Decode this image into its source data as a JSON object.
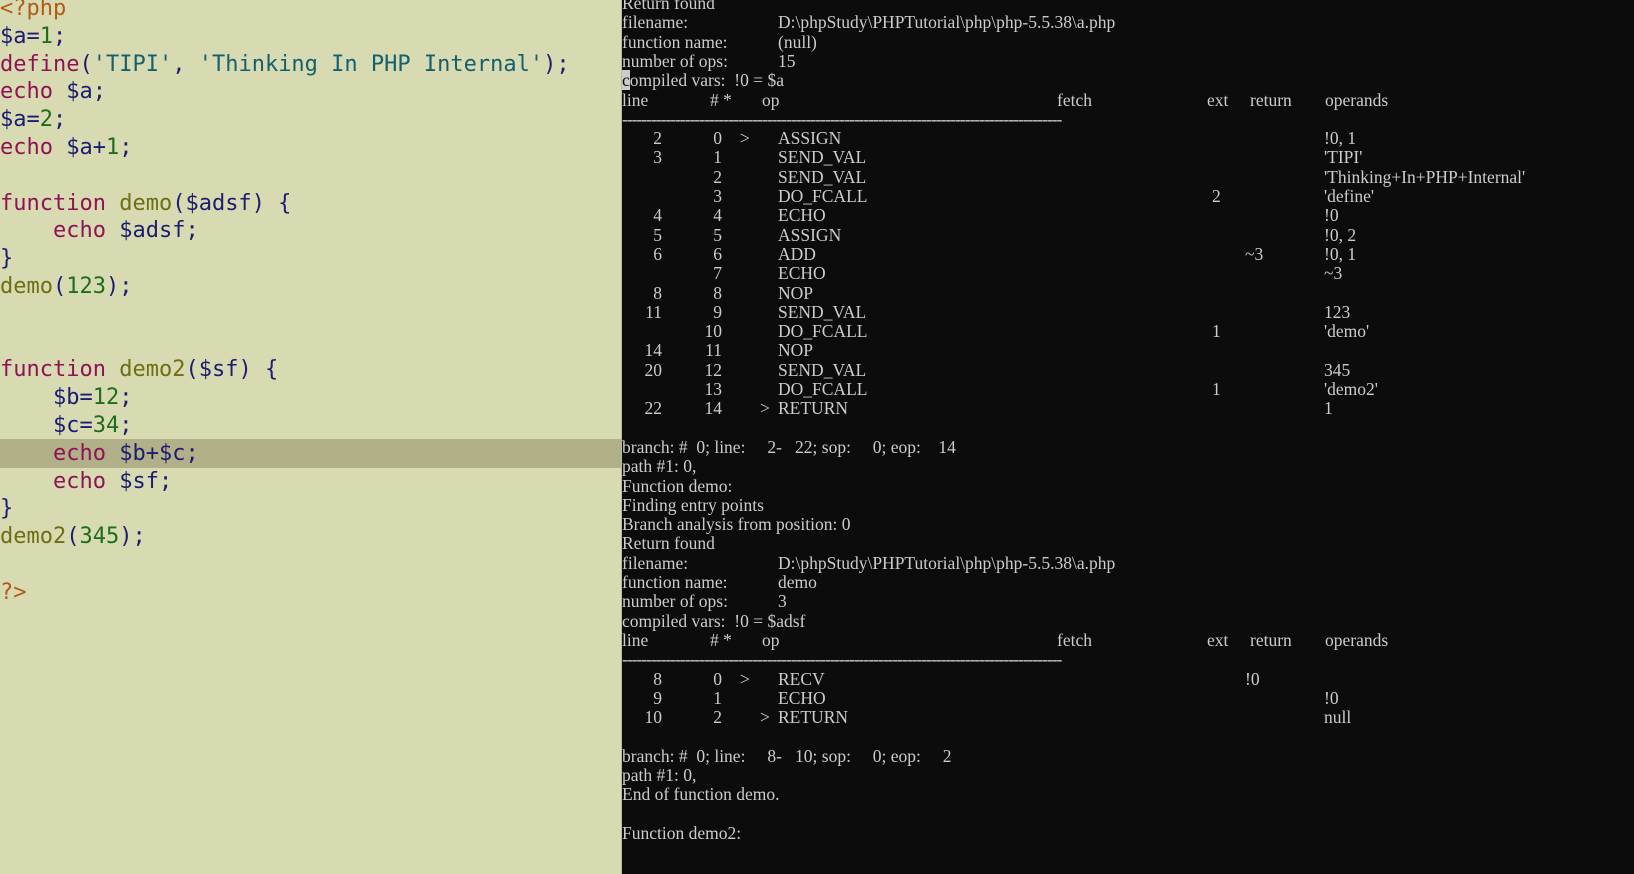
{
  "editor": {
    "current_line_index": 16,
    "lines": [
      [
        {
          "t": "<?php",
          "c": "tag"
        }
      ],
      [
        {
          "t": "$a",
          "c": "var"
        },
        {
          "t": "=",
          "c": "punc"
        },
        {
          "t": "1",
          "c": "num"
        },
        {
          "t": ";",
          "c": "punc"
        }
      ],
      [
        {
          "t": "define",
          "c": "kw"
        },
        {
          "t": "(",
          "c": "punc"
        },
        {
          "t": "'TIPI'",
          "c": "str"
        },
        {
          "t": ", ",
          "c": "punc"
        },
        {
          "t": "'Thinking In PHP Internal'",
          "c": "str"
        },
        {
          "t": ");",
          "c": "punc"
        }
      ],
      [
        {
          "t": "echo",
          "c": "kw"
        },
        {
          "t": " $a;",
          "c": "var"
        }
      ],
      [
        {
          "t": "$a",
          "c": "var"
        },
        {
          "t": "=",
          "c": "punc"
        },
        {
          "t": "2",
          "c": "num"
        },
        {
          "t": ";",
          "c": "punc"
        }
      ],
      [
        {
          "t": "echo",
          "c": "kw"
        },
        {
          "t": " $a",
          "c": "var"
        },
        {
          "t": "+",
          "c": "punc"
        },
        {
          "t": "1",
          "c": "num"
        },
        {
          "t": ";",
          "c": "punc"
        }
      ],
      [],
      [
        {
          "t": "function",
          "c": "kw"
        },
        {
          "t": " ",
          "c": "punc"
        },
        {
          "t": "demo",
          "c": "fn"
        },
        {
          "t": "(",
          "c": "punc"
        },
        {
          "t": "$adsf",
          "c": "var"
        },
        {
          "t": ") {",
          "c": "punc"
        }
      ],
      [
        {
          "t": "    ",
          "c": "punc"
        },
        {
          "t": "echo",
          "c": "kw"
        },
        {
          "t": " $adsf;",
          "c": "var"
        }
      ],
      [
        {
          "t": "}",
          "c": "punc"
        }
      ],
      [
        {
          "t": "demo",
          "c": "fn"
        },
        {
          "t": "(",
          "c": "punc"
        },
        {
          "t": "123",
          "c": "num"
        },
        {
          "t": ");",
          "c": "punc"
        }
      ],
      [],
      [],
      [
        {
          "t": "function",
          "c": "kw"
        },
        {
          "t": " ",
          "c": "punc"
        },
        {
          "t": "demo2",
          "c": "fn"
        },
        {
          "t": "(",
          "c": "punc"
        },
        {
          "t": "$sf",
          "c": "var"
        },
        {
          "t": ") {",
          "c": "punc"
        }
      ],
      [
        {
          "t": "    ",
          "c": "punc"
        },
        {
          "t": "$b",
          "c": "var"
        },
        {
          "t": "=",
          "c": "punc"
        },
        {
          "t": "12",
          "c": "num"
        },
        {
          "t": ";",
          "c": "punc"
        }
      ],
      [
        {
          "t": "    ",
          "c": "punc"
        },
        {
          "t": "$c",
          "c": "var"
        },
        {
          "t": "=",
          "c": "punc"
        },
        {
          "t": "34",
          "c": "num"
        },
        {
          "t": ";",
          "c": "punc"
        }
      ],
      [
        {
          "t": "    ",
          "c": "punc"
        },
        {
          "t": "echo",
          "c": "kw"
        },
        {
          "t": " $b",
          "c": "var"
        },
        {
          "t": "+",
          "c": "punc"
        },
        {
          "t": "$c;",
          "c": "var"
        }
      ],
      [
        {
          "t": "    ",
          "c": "punc"
        },
        {
          "t": "echo",
          "c": "kw"
        },
        {
          "t": " $sf;",
          "c": "var"
        }
      ],
      [
        {
          "t": "}",
          "c": "punc"
        }
      ],
      [
        {
          "t": "demo2",
          "c": "fn"
        },
        {
          "t": "(",
          "c": "punc"
        },
        {
          "t": "345",
          "c": "num"
        },
        {
          "t": ");",
          "c": "punc"
        }
      ],
      [],
      [
        {
          "t": "?>",
          "c": "tag"
        }
      ]
    ]
  },
  "console": {
    "lines": [
      {
        "k": "text",
        "text": "Return found"
      },
      {
        "k": "kv",
        "label": "filename:",
        "value": "D:\\phpStudy\\PHPTutorial\\php\\php-5.5.38\\a.php"
      },
      {
        "k": "kv",
        "label": "function name:",
        "value": "(null)"
      },
      {
        "k": "kv",
        "label": "number of ops:",
        "value": "15"
      },
      {
        "k": "cursor",
        "cursor": "c",
        "text": "ompiled vars:  !0 = $a"
      },
      {
        "k": "header",
        "line": "line",
        "num": "# *",
        "op": "op",
        "fetch": "fetch",
        "ext": "ext",
        "ret": "return",
        "operands": "operands"
      },
      {
        "k": "sep"
      },
      {
        "k": "op",
        "line": "2",
        "num": "0",
        "mark": ">",
        "op": "ASSIGN",
        "ext": "",
        "ret": "",
        "operands": "!0, 1"
      },
      {
        "k": "op",
        "line": "3",
        "num": "1",
        "mark": "",
        "op": "SEND_VAL",
        "ext": "",
        "ret": "",
        "operands": "'TIPI'"
      },
      {
        "k": "op",
        "line": "",
        "num": "2",
        "mark": "",
        "op": "SEND_VAL",
        "ext": "",
        "ret": "",
        "operands": "'Thinking+In+PHP+Internal'"
      },
      {
        "k": "op",
        "line": "",
        "num": "3",
        "mark": "",
        "op": "DO_FCALL",
        "ext": "2",
        "ret": "",
        "operands": "'define'"
      },
      {
        "k": "op",
        "line": "4",
        "num": "4",
        "mark": "",
        "op": "ECHO",
        "ext": "",
        "ret": "",
        "operands": "!0"
      },
      {
        "k": "op",
        "line": "5",
        "num": "5",
        "mark": "",
        "op": "ASSIGN",
        "ext": "",
        "ret": "",
        "operands": "!0, 2"
      },
      {
        "k": "op",
        "line": "6",
        "num": "6",
        "mark": "",
        "op": "ADD",
        "ext": "",
        "ret": "~3",
        "operands": "!0, 1"
      },
      {
        "k": "op",
        "line": "",
        "num": "7",
        "mark": "",
        "op": "ECHO",
        "ext": "",
        "ret": "",
        "operands": "~3"
      },
      {
        "k": "op",
        "line": "8",
        "num": "8",
        "mark": "",
        "op": "NOP",
        "ext": "",
        "ret": "",
        "operands": ""
      },
      {
        "k": "op",
        "line": "11",
        "num": "9",
        "mark": "",
        "op": "SEND_VAL",
        "ext": "",
        "ret": "",
        "operands": "123"
      },
      {
        "k": "op",
        "line": "",
        "num": "10",
        "mark": "",
        "op": "DO_FCALL",
        "ext": "1",
        "ret": "",
        "operands": "'demo'"
      },
      {
        "k": "op",
        "line": "14",
        "num": "11",
        "mark": "",
        "op": "NOP",
        "ext": "",
        "ret": "",
        "operands": ""
      },
      {
        "k": "op",
        "line": "20",
        "num": "12",
        "mark": "",
        "op": "SEND_VAL",
        "ext": "",
        "ret": "",
        "operands": "345"
      },
      {
        "k": "op",
        "line": "",
        "num": "13",
        "mark": "",
        "op": "DO_FCALL",
        "ext": "1",
        "ret": "",
        "operands": "'demo2'"
      },
      {
        "k": "op",
        "line": "22",
        "num": "14",
        "mark": ">",
        "op": "RETURN",
        "ext": "",
        "ret": "",
        "operands": "1"
      },
      {
        "k": "blank"
      },
      {
        "k": "text",
        "text": "branch: #  0; line:     2-   22; sop:     0; eop:    14"
      },
      {
        "k": "text",
        "text": "path #1: 0,"
      },
      {
        "k": "text",
        "text": "Function demo:"
      },
      {
        "k": "text",
        "text": "Finding entry points"
      },
      {
        "k": "text",
        "text": "Branch analysis from position: 0"
      },
      {
        "k": "text",
        "text": "Return found"
      },
      {
        "k": "kv",
        "label": "filename:",
        "value": "D:\\phpStudy\\PHPTutorial\\php\\php-5.5.38\\a.php"
      },
      {
        "k": "kv",
        "label": "function name:",
        "value": "demo"
      },
      {
        "k": "kv",
        "label": "number of ops:",
        "value": "3"
      },
      {
        "k": "text",
        "text": "compiled vars:  !0 = $adsf"
      },
      {
        "k": "header",
        "line": "line",
        "num": "# *",
        "op": "op",
        "fetch": "fetch",
        "ext": "ext",
        "ret": "return",
        "operands": "operands"
      },
      {
        "k": "sep"
      },
      {
        "k": "op",
        "line": "8",
        "num": "0",
        "mark": ">",
        "op": "RECV",
        "ext": "",
        "ret": "!0",
        "operands": ""
      },
      {
        "k": "op",
        "line": "9",
        "num": "1",
        "mark": "",
        "op": "ECHO",
        "ext": "",
        "ret": "",
        "operands": "!0"
      },
      {
        "k": "op",
        "line": "10",
        "num": "2",
        "mark": ">",
        "op": "RETURN",
        "ext": "",
        "ret": "",
        "operands": "null"
      },
      {
        "k": "blank"
      },
      {
        "k": "text",
        "text": "branch: #  0; line:     8-   10; sop:     0; eop:     2"
      },
      {
        "k": "text",
        "text": "path #1: 0,"
      },
      {
        "k": "text",
        "text": "End of function demo."
      },
      {
        "k": "blank"
      },
      {
        "k": "text",
        "text": "Function demo2:"
      }
    ],
    "separator": "-------------------------------------------------------------------------------------------"
  }
}
